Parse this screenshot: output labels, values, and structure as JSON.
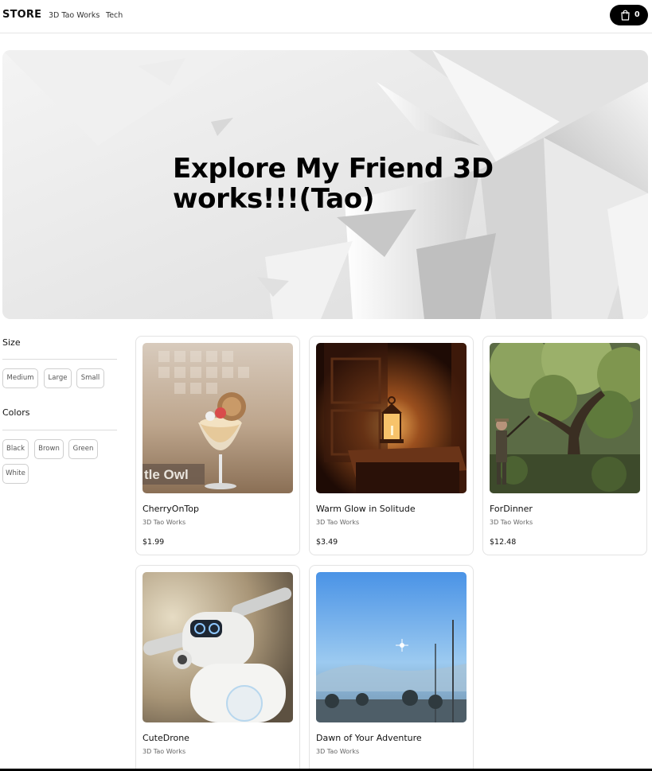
{
  "nav": {
    "brand": "STORE",
    "links": [
      "3D Tao Works",
      "Tech"
    ],
    "cart_count": "0"
  },
  "hero": {
    "title": "Explore My Friend 3D works!!!(Tao)"
  },
  "filters": {
    "size_label": "Size",
    "sizes": [
      "Medium",
      "Large",
      "Small"
    ],
    "colors_label": "Colors",
    "colors": [
      "Black",
      "Brown",
      "Green",
      "White"
    ]
  },
  "products": [
    {
      "name": "CherryOnTop",
      "category": "3D Tao Works",
      "price": "$1.99",
      "image_overlay": "tle Owl",
      "image": "dessert-glass-image"
    },
    {
      "name": "Warm Glow in Solitude",
      "category": "3D Tao Works",
      "price": "$3.49",
      "image": "lantern-room-image"
    },
    {
      "name": "ForDinner",
      "category": "3D Tao Works",
      "price": "$12.48",
      "image": "forest-hunter-image"
    },
    {
      "name": "CuteDrone",
      "category": "3D Tao Works",
      "price": "",
      "image": "drone-robot-image"
    },
    {
      "name": "Dawn of Your Adventure",
      "category": "3D Tao Works",
      "price": "",
      "image": "sky-landscape-image"
    }
  ],
  "colors": {
    "accent": "#000000",
    "border": "#e3e3e3"
  }
}
